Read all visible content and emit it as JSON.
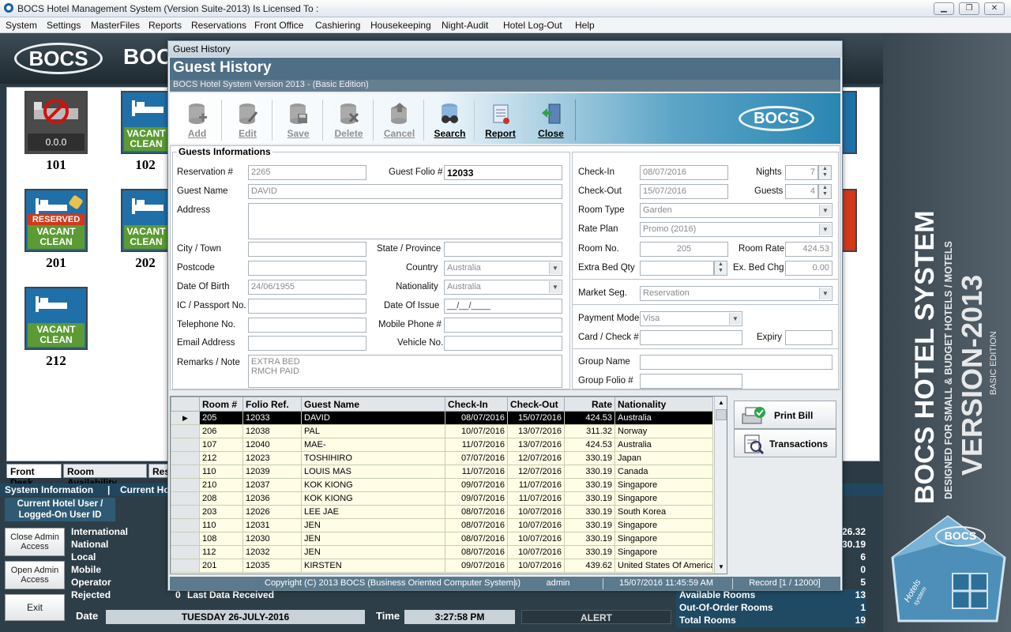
{
  "window": {
    "title": "BOCS Hotel Management System (Version Suite-2013) Is Licensed To :"
  },
  "menu": [
    "System",
    "Settings",
    "MasterFiles",
    "Reports",
    "Reservations",
    "Front Office",
    "Cashiering",
    "Housekeeping",
    "Night-Audit",
    "Hotel Log-Out",
    "Help"
  ],
  "banner": {
    "logo": "BOCS",
    "logo_partial": "BOC"
  },
  "rooms": [
    {
      "num": "101",
      "status": "0.0.0",
      "type": "ooo"
    },
    {
      "num": "102",
      "status": "VACANT CLEAN",
      "type": "vacant"
    },
    {
      "num": "201",
      "status": "VACANT CLEAN",
      "type": "reserved",
      "tag": "RESERVED"
    },
    {
      "num": "202",
      "status": "VACANT CLEAN",
      "type": "vacant"
    },
    {
      "num": "212",
      "status": "VACANT CLEAN",
      "type": "vacant"
    }
  ],
  "room_labels": {
    "vacant": "VACANT",
    "clean": "CLEAN",
    "reserved": "RESERVED",
    "ooo": "0.0.0"
  },
  "tabs": [
    "Front Desk",
    "Room Availability",
    "Res"
  ],
  "sysbar": {
    "left": "System Information",
    "sep": "|",
    "right": "Current Ho"
  },
  "current_user": "Current Hotel User / Logged-On User ID",
  "side_buttons": [
    "Close Admin Access",
    "Open Admin Access",
    "Exit"
  ],
  "stats_left": [
    {
      "label": "International",
      "value": ""
    },
    {
      "label": "National",
      "value": ""
    },
    {
      "label": "Local",
      "value": ""
    },
    {
      "label": "Mobile",
      "value": ""
    },
    {
      "label": "Operator",
      "value": ""
    },
    {
      "label": "Rejected",
      "value": "0"
    }
  ],
  "last_data": "Last Data Received",
  "date_label": "Date",
  "date_value": "TUESDAY   26-JULY-2016",
  "time_label": "Time",
  "time_value": "3:27:58 PM",
  "alert": "ALERT",
  "stats_right": [
    {
      "label": "",
      "value": "26.32"
    },
    {
      "label": "",
      "value": "30.19"
    },
    {
      "label": "",
      "value": "6"
    },
    {
      "label": "",
      "value": "0"
    },
    {
      "label": "",
      "value": "5"
    },
    {
      "label": "Available Rooms",
      "value": "13"
    },
    {
      "label": "Out-Of-Order Rooms",
      "value": "1"
    },
    {
      "label": "Total Rooms",
      "value": "19"
    }
  ],
  "side_brand": {
    "line1": "BOCS HOTEL SYSTEM",
    "line2": "DESIGNED FOR SMALL & BUDGET HOTELS / MOTELS",
    "line3": "VERSION-2013",
    "line4": "BASIC EDITION",
    "house": "BOCS",
    "house_sub": "Hotels",
    "house_sub2": "system"
  },
  "modal": {
    "window_title": "Guest History",
    "heading": "Guest History",
    "subtitle": "BOCS Hotel System Version 2013 - (Basic Edition)",
    "logo": "BOCS",
    "toolbar": [
      {
        "label": "Add",
        "icon": "add-db-icon",
        "enabled": false
      },
      {
        "label": "Edit",
        "icon": "edit-db-icon",
        "enabled": false
      },
      {
        "label": "Save",
        "icon": "save-icon",
        "enabled": false
      },
      {
        "label": "Delete",
        "icon": "delete-icon",
        "enabled": false
      },
      {
        "label": "Cancel",
        "icon": "cancel-icon",
        "enabled": false
      },
      {
        "label": "Search",
        "icon": "search-binoculars-icon",
        "enabled": true
      },
      {
        "label": "Report",
        "icon": "report-scroll-icon",
        "enabled": true
      },
      {
        "label": "Close",
        "icon": "exit-door-icon",
        "enabled": true
      }
    ],
    "section": "Guests Informations",
    "fields": {
      "reservation_label": "Reservation #",
      "reservation": "2265",
      "folio_label": "Guest Folio #",
      "folio": "12033",
      "guest_name_label": "Guest Name",
      "guest_name": "DAVID",
      "address_label": "Address",
      "address": "",
      "city_label": "City / Town",
      "city": "",
      "state_label": "State / Province",
      "state": "",
      "postcode_label": "Postcode",
      "postcode": "",
      "country_label": "Country",
      "country": "Australia",
      "dob_label": "Date Of Birth",
      "dob": "24/06/1955",
      "nationality_label": "Nationality",
      "nationality": "Australia",
      "ic_label": "IC / Passport No.",
      "ic": "",
      "issue_label": "Date Of Issue",
      "issue": "__/__/____",
      "tel_label": "Telephone No.",
      "tel": "",
      "mobile_label": "Mobile Phone #",
      "mobile": "",
      "email_label": "Email Address",
      "email": "",
      "vehicle_label": "Vehicle No.",
      "vehicle": "",
      "remarks_label": "Remarks / Note",
      "remarks": "EXTRA BED\nRMCH PAID",
      "checkin_label": "Check-In",
      "checkin": "08/07/2016",
      "nights_label": "Nights",
      "nights": "7",
      "checkout_label": "Check-Out",
      "checkout": "15/07/2016",
      "guests_label": "Guests",
      "guests": "4",
      "roomtype_label": "Room Type",
      "roomtype": "Garden",
      "rateplan_label": "Rate Plan",
      "rateplan": "Promo (2016)",
      "roomno_label": "Room No.",
      "roomno": "205",
      "roomrate_label": "Room Rate",
      "roomrate": "424.53",
      "extrabed_label": "Extra Bed Qty",
      "extrabed": "",
      "exbedchg_label": "Ex. Bed Chg",
      "exbedchg": "0.00",
      "market_label": "Market Seg.",
      "market": "Reservation",
      "payment_label": "Payment Mode",
      "payment": "Visa",
      "card_label": "Card / Check #",
      "card": "",
      "expiry_label": "Expiry",
      "expiry": "",
      "group_label": "Group Name",
      "group": "",
      "groupfolio_label": "Group Folio #",
      "groupfolio": ""
    },
    "grid": {
      "columns": [
        "Room #",
        "Folio Ref.",
        "Guest Name",
        "Check-In",
        "Check-Out",
        "Rate",
        "Nationality"
      ],
      "rows": [
        [
          "205",
          "12033",
          "DAVID",
          "08/07/2016",
          "15/07/2016",
          "424.53",
          "Australia"
        ],
        [
          "206",
          "12038",
          "PAL",
          "10/07/2016",
          "13/07/2016",
          "311.32",
          "Norway"
        ],
        [
          "107",
          "12040",
          "MAE-",
          "11/07/2016",
          "13/07/2016",
          "424.53",
          "Australia"
        ],
        [
          "212",
          "12023",
          "TOSHIHIRO",
          "07/07/2016",
          "12/07/2016",
          "330.19",
          "Japan"
        ],
        [
          "110",
          "12039",
          "LOUIS MAS",
          "11/07/2016",
          "12/07/2016",
          "330.19",
          "Canada"
        ],
        [
          "210",
          "12037",
          "KOK KIONG",
          "09/07/2016",
          "11/07/2016",
          "330.19",
          "Singapore"
        ],
        [
          "208",
          "12036",
          "KOK KIONG",
          "09/07/2016",
          "11/07/2016",
          "330.19",
          "Singapore"
        ],
        [
          "203",
          "12026",
          "LEE JAE",
          "08/07/2016",
          "10/07/2016",
          "330.19",
          "South Korea"
        ],
        [
          "110",
          "12031",
          "JEN",
          "08/07/2016",
          "10/07/2016",
          "330.19",
          "Singapore"
        ],
        [
          "108",
          "12030",
          "JEN",
          "08/07/2016",
          "10/07/2016",
          "330.19",
          "Singapore"
        ],
        [
          "112",
          "12032",
          "JEN",
          "08/07/2016",
          "10/07/2016",
          "330.19",
          "Singapore"
        ],
        [
          "201",
          "12035",
          "KIRSTEN",
          "09/07/2016",
          "10/07/2016",
          "439.62",
          "United States Of America"
        ]
      ]
    },
    "print_bill": "Print Bill",
    "transactions": "Transactions",
    "status": {
      "copyright": "Copyright (C) 2013 BOCS (Business Oriented Computer Systems)",
      "user": "admin",
      "datetime": "15/07/2016 11:45:59 AM",
      "record": "Record  [1 / 12000]"
    }
  }
}
